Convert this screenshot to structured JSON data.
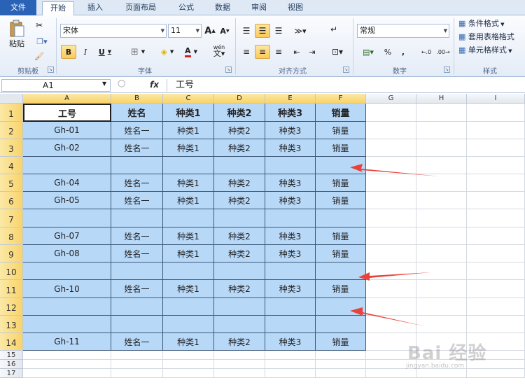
{
  "ribbon": {
    "tabs": [
      "文件",
      "开始",
      "插入",
      "页面布局",
      "公式",
      "数据",
      "审阅",
      "视图"
    ],
    "active_tab": "开始",
    "clipboard": {
      "paste_label": "粘贴",
      "group_label": "剪贴板"
    },
    "font": {
      "name": "宋体",
      "size": "11",
      "grow": "A",
      "shrink": "A",
      "bold": "B",
      "italic": "I",
      "underline": "U",
      "font_color": "A",
      "group_label": "字体",
      "wen": "wén"
    },
    "alignment": {
      "group_label": "对齐方式"
    },
    "number": {
      "format": "常规",
      "percent": "%",
      "comma": ",",
      "group_label": "数字"
    },
    "styles": {
      "conditional": "条件格式",
      "table_format": "套用表格格式",
      "cell_styles": "单元格样式",
      "group_label": "样式"
    }
  },
  "formula_bar": {
    "name_box": "A1",
    "fx": "fx",
    "content": "工号"
  },
  "columns": [
    "A",
    "B",
    "C",
    "D",
    "E",
    "F",
    "G",
    "H",
    "I"
  ],
  "rows": [
    "1",
    "2",
    "3",
    "4",
    "5",
    "6",
    "7",
    "8",
    "9",
    "10",
    "11",
    "12",
    "13",
    "14",
    "15",
    "16",
    "17"
  ],
  "table": {
    "headers": [
      "工号",
      "姓名",
      "种类1",
      "种类2",
      "种类3",
      "销量"
    ],
    "data": [
      [
        "Gh-01",
        "姓名一",
        "种类1",
        "种类2",
        "种类3",
        "销量"
      ],
      [
        "Gh-02",
        "姓名一",
        "种类1",
        "种类2",
        "种类3",
        "销量"
      ],
      [
        "",
        "",
        "",
        "",
        "",
        ""
      ],
      [
        "Gh-04",
        "姓名一",
        "种类1",
        "种类2",
        "种类3",
        "销量"
      ],
      [
        "Gh-05",
        "姓名一",
        "种类1",
        "种类2",
        "种类3",
        "销量"
      ],
      [
        "",
        "",
        "",
        "",
        "",
        ""
      ],
      [
        "Gh-07",
        "姓名一",
        "种类1",
        "种类2",
        "种类3",
        "销量"
      ],
      [
        "Gh-08",
        "姓名一",
        "种类1",
        "种类2",
        "种类3",
        "销量"
      ],
      [
        "",
        "",
        "",
        "",
        "",
        ""
      ],
      [
        "Gh-10",
        "姓名一",
        "种类1",
        "种类2",
        "种类3",
        "销量"
      ],
      [
        "",
        "",
        "",
        "",
        "",
        ""
      ],
      [
        "",
        "",
        "",
        "",
        "",
        ""
      ],
      [
        "Gh-11",
        "姓名一",
        "种类1",
        "种类2",
        "种类3",
        "销量"
      ]
    ]
  },
  "watermark": {
    "text": "Bai 经验",
    "url": "jingyan.baidu.com"
  },
  "colors": {
    "selection_fill": "#b8d8f8",
    "arrow": "#e8423a",
    "file_tab": "#2a62b6"
  }
}
